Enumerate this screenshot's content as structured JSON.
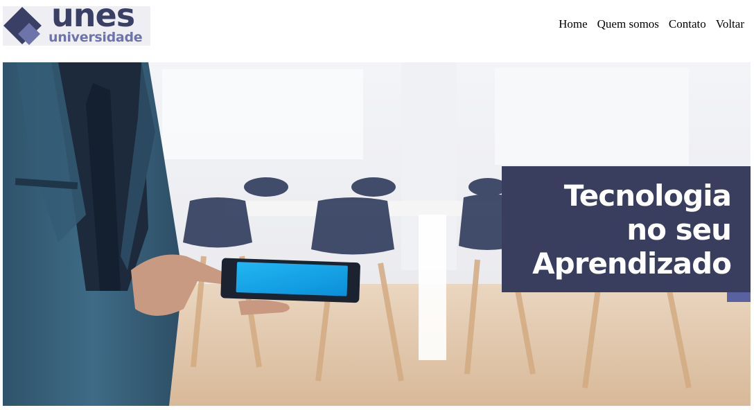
{
  "header": {
    "logo": {
      "word_main": "unes",
      "word_sub": "universidade",
      "brand_color": "#3a3f66",
      "accent_color": "#6d74aa"
    },
    "nav": [
      {
        "label": "Home"
      },
      {
        "label": "Quem somos"
      },
      {
        "label": "Contato"
      },
      {
        "label": "Voltar"
      }
    ]
  },
  "hero": {
    "headline": {
      "line1": "Tecnologia",
      "line2": "no seu",
      "line3": "Aprendizado"
    },
    "box_color": "#393d5e",
    "tablet_screen_color": "#0fa3ea"
  }
}
